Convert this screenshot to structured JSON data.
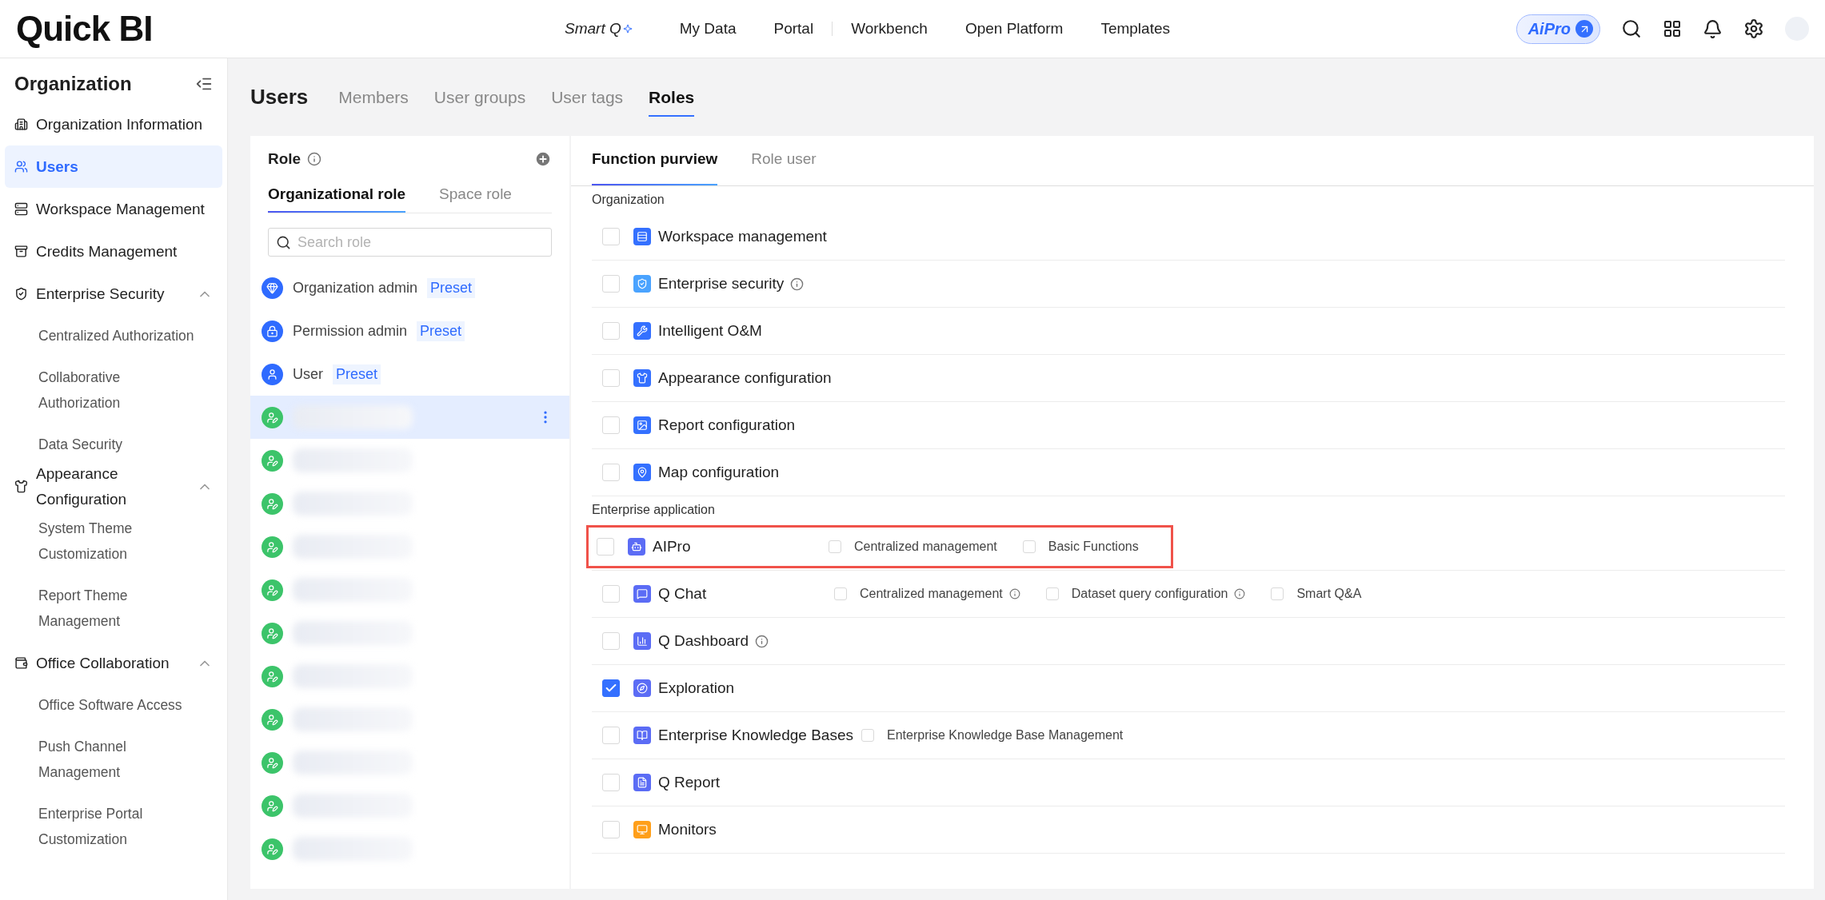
{
  "top_bar": {
    "logo": "Quick BI",
    "smart_q": "Smart Q",
    "nav": [
      {
        "label": "My Data",
        "divider_after": false
      },
      {
        "label": "Portal",
        "divider_after": true
      },
      {
        "label": "Workbench",
        "divider_after": false
      },
      {
        "label": "Open Platform",
        "divider_after": false
      },
      {
        "label": "Templates",
        "divider_after": false
      }
    ],
    "ai_pro": "AiPro"
  },
  "sidebar": {
    "title": "Organization",
    "items": [
      {
        "label": "Organization Information",
        "selected": false
      },
      {
        "label": "Users",
        "selected": true
      },
      {
        "label": "Workspace Management",
        "selected": false
      },
      {
        "label": "Credits Management",
        "selected": false
      },
      {
        "label": "Enterprise Security",
        "selected": false,
        "expanded": true,
        "children": [
          {
            "label": "Centralized Authorization"
          },
          {
            "label": "Collaborative Authorization"
          },
          {
            "label": "Data Security"
          }
        ]
      },
      {
        "label": "Appearance Configuration",
        "selected": false,
        "expanded": true,
        "children": [
          {
            "label": "System Theme Customization"
          },
          {
            "label": "Report Theme Management"
          }
        ]
      },
      {
        "label": "Office Collaboration",
        "selected": false,
        "expanded": true,
        "children": [
          {
            "label": "Office Software Access"
          },
          {
            "label": "Push Channel Management"
          },
          {
            "label": "Enterprise Portal Customization"
          }
        ]
      }
    ]
  },
  "page": {
    "title": "Users",
    "tabs": [
      {
        "label": "Members",
        "selected": false
      },
      {
        "label": "User groups",
        "selected": false
      },
      {
        "label": "User tags",
        "selected": false
      },
      {
        "label": "Roles",
        "selected": true
      }
    ]
  },
  "role_panel": {
    "title": "Role",
    "tabs": [
      {
        "label": "Organizational role",
        "selected": true
      },
      {
        "label": "Space role",
        "selected": false
      }
    ],
    "search": {
      "placeholder": "Search role"
    },
    "preset_roles": [
      {
        "name": "Organization admin",
        "badge": "Preset"
      },
      {
        "name": "Permission admin",
        "badge": "Preset"
      },
      {
        "name": "User",
        "badge": "Preset"
      }
    ],
    "custom_roles": [
      {
        "selected": true
      },
      {
        "selected": false
      },
      {
        "selected": false
      },
      {
        "selected": false
      },
      {
        "selected": false
      },
      {
        "selected": false
      },
      {
        "selected": false
      },
      {
        "selected": false
      },
      {
        "selected": false
      },
      {
        "selected": false
      },
      {
        "selected": false
      }
    ]
  },
  "permission_panel": {
    "tabs": [
      {
        "label": "Function purview",
        "selected": true
      },
      {
        "label": "Role user",
        "selected": false
      }
    ],
    "rows": [
      {
        "kind": "header",
        "label": "Organization"
      },
      {
        "kind": "item",
        "label": "Workspace management",
        "checked": false,
        "info": false,
        "highlighted": false,
        "color": "#3470ff"
      },
      {
        "kind": "item",
        "label": "Enterprise security",
        "checked": false,
        "info": true,
        "highlighted": false,
        "color": "#4aa3ff"
      },
      {
        "kind": "item",
        "label": "Intelligent O&M",
        "checked": false,
        "info": false,
        "highlighted": false,
        "color": "#3470ff"
      },
      {
        "kind": "item",
        "label": "Appearance configuration",
        "checked": false,
        "info": false,
        "highlighted": false,
        "color": "#3470ff"
      },
      {
        "kind": "item",
        "label": "Report configuration",
        "checked": false,
        "info": false,
        "highlighted": false,
        "color": "#3470ff"
      },
      {
        "kind": "item",
        "label": "Map configuration",
        "checked": false,
        "info": false,
        "highlighted": false,
        "color": "#3470ff"
      },
      {
        "kind": "header",
        "label": "Enterprise application"
      },
      {
        "kind": "item",
        "label": "AIPro",
        "checked": false,
        "info": false,
        "highlighted": true,
        "color": "#5b6cf5",
        "options": [
          {
            "label": "Centralized management",
            "checked": false,
            "info": false
          },
          {
            "label": "Basic Functions",
            "checked": false,
            "info": false
          }
        ]
      },
      {
        "kind": "item",
        "label": "Q Chat",
        "checked": false,
        "info": false,
        "highlighted": false,
        "color": "#5b6cf5",
        "options": [
          {
            "label": "Centralized management",
            "checked": false,
            "info": true
          },
          {
            "label": "Dataset query configuration",
            "checked": false,
            "info": true
          },
          {
            "label": "Smart Q&A",
            "checked": false,
            "info": false
          }
        ]
      },
      {
        "kind": "item",
        "label": "Q Dashboard",
        "checked": false,
        "info": true,
        "highlighted": false,
        "color": "#5b6cf5"
      },
      {
        "kind": "item",
        "label": "Exploration",
        "checked": true,
        "info": false,
        "highlighted": false,
        "color": "#5b6cf5"
      },
      {
        "kind": "item",
        "label": "Enterprise Knowledge Bases",
        "checked": false,
        "info": false,
        "highlighted": false,
        "color": "#5b6cf5",
        "options": [
          {
            "label": "Enterprise Knowledge Base Management",
            "checked": false,
            "info": false
          }
        ]
      },
      {
        "kind": "item",
        "label": "Q Report",
        "checked": false,
        "info": false,
        "highlighted": false,
        "color": "#5b6cf5"
      },
      {
        "kind": "item",
        "label": "Monitors",
        "checked": false,
        "info": false,
        "highlighted": false,
        "color": "#ff9f1a"
      }
    ]
  }
}
